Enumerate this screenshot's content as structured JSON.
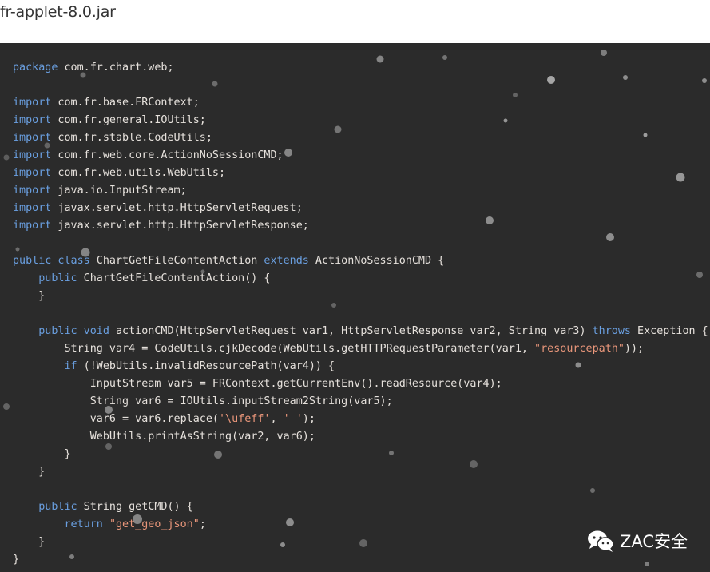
{
  "file_header": {
    "title": "fr-applet-8.0.jar"
  },
  "code": {
    "language": "java",
    "colors": {
      "keyword": "#6a9fe0",
      "string": "#e9967a",
      "plain": "#e6e1dc",
      "background": "#2b2b2b"
    },
    "lines": [
      [
        {
          "t": "kw",
          "v": "package"
        },
        {
          "t": "plain",
          "v": " com.fr.chart.web;"
        }
      ],
      [],
      [
        {
          "t": "kw",
          "v": "import"
        },
        {
          "t": "plain",
          "v": " com.fr.base.FRContext;"
        }
      ],
      [
        {
          "t": "kw",
          "v": "import"
        },
        {
          "t": "plain",
          "v": " com.fr.general.IOUtils;"
        }
      ],
      [
        {
          "t": "kw",
          "v": "import"
        },
        {
          "t": "plain",
          "v": " com.fr.stable.CodeUtils;"
        }
      ],
      [
        {
          "t": "kw",
          "v": "import"
        },
        {
          "t": "plain",
          "v": " com.fr.web.core.ActionNoSessionCMD;"
        }
      ],
      [
        {
          "t": "kw",
          "v": "import"
        },
        {
          "t": "plain",
          "v": " com.fr.web.utils.WebUtils;"
        }
      ],
      [
        {
          "t": "kw",
          "v": "import"
        },
        {
          "t": "plain",
          "v": " java.io.InputStream;"
        }
      ],
      [
        {
          "t": "kw",
          "v": "import"
        },
        {
          "t": "plain",
          "v": " javax.servlet.http.HttpServletRequest;"
        }
      ],
      [
        {
          "t": "kw",
          "v": "import"
        },
        {
          "t": "plain",
          "v": " javax.servlet.http.HttpServletResponse;"
        }
      ],
      [],
      [
        {
          "t": "kw",
          "v": "public class"
        },
        {
          "t": "plain",
          "v": " ChartGetFileContentAction "
        },
        {
          "t": "kw",
          "v": "extends"
        },
        {
          "t": "plain",
          "v": " ActionNoSessionCMD {"
        }
      ],
      [
        {
          "t": "plain",
          "v": "    "
        },
        {
          "t": "kw",
          "v": "public"
        },
        {
          "t": "plain",
          "v": " ChartGetFileContentAction() {"
        }
      ],
      [
        {
          "t": "plain",
          "v": "    }"
        }
      ],
      [],
      [
        {
          "t": "plain",
          "v": "    "
        },
        {
          "t": "kw",
          "v": "public void"
        },
        {
          "t": "plain",
          "v": " actionCMD(HttpServletRequest var1, HttpServletResponse var2, String var3) "
        },
        {
          "t": "kw",
          "v": "throws"
        },
        {
          "t": "plain",
          "v": " Exception {"
        }
      ],
      [
        {
          "t": "plain",
          "v": "        String var4 = CodeUtils.cjkDecode(WebUtils.getHTTPRequestParameter(var1, "
        },
        {
          "t": "str",
          "v": "\"resourcepath\""
        },
        {
          "t": "plain",
          "v": "));"
        }
      ],
      [
        {
          "t": "plain",
          "v": "        "
        },
        {
          "t": "kw",
          "v": "if"
        },
        {
          "t": "plain",
          "v": " (!WebUtils.invalidResourcePath(var4)) {"
        }
      ],
      [
        {
          "t": "plain",
          "v": "            InputStream var5 = FRContext.getCurrentEnv().readResource(var4);"
        }
      ],
      [
        {
          "t": "plain",
          "v": "            String var6 = IOUtils.inputStream2String(var5);"
        }
      ],
      [
        {
          "t": "plain",
          "v": "            var6 = var6.replace("
        },
        {
          "t": "str",
          "v": "'\\ufeff'"
        },
        {
          "t": "plain",
          "v": ", "
        },
        {
          "t": "str",
          "v": "' '"
        },
        {
          "t": "plain",
          "v": ");"
        }
      ],
      [
        {
          "t": "plain",
          "v": "            WebUtils.printAsString(var2, var6);"
        }
      ],
      [
        {
          "t": "plain",
          "v": "        }"
        }
      ],
      [
        {
          "t": "plain",
          "v": "    }"
        }
      ],
      [],
      [
        {
          "t": "plain",
          "v": "    "
        },
        {
          "t": "kw",
          "v": "public"
        },
        {
          "t": "plain",
          "v": " String getCMD() {"
        }
      ],
      [
        {
          "t": "plain",
          "v": "        "
        },
        {
          "t": "kw",
          "v": "return"
        },
        {
          "t": "plain",
          "v": " "
        },
        {
          "t": "str",
          "v": "\"get_geo_json\""
        },
        {
          "t": "plain",
          "v": ";"
        }
      ],
      [
        {
          "t": "plain",
          "v": "    }"
        }
      ],
      [
        {
          "t": "plain",
          "v": "}"
        }
      ]
    ]
  },
  "watermark": {
    "icon": "wechat-icon",
    "text": "ZAC安全"
  }
}
